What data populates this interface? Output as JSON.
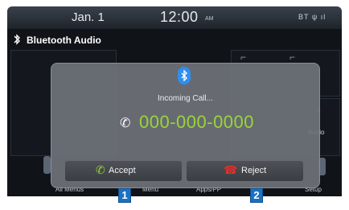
{
  "status_bar": {
    "date": "Jan. 1",
    "time": "12:00",
    "ampm": "AM",
    "icons_text": "BT ψ ıl"
  },
  "header": {
    "bt_icon": "bluetooth-phone-icon",
    "title": "Bluetooth Audio"
  },
  "background": {
    "side_label": "Audio"
  },
  "bottom_menu": {
    "items": [
      "All Menus",
      "Menu",
      "Apps/PP",
      "Setup"
    ]
  },
  "popup": {
    "bt_icon": "bluetooth-icon",
    "title": "Incoming Call...",
    "phone_number": "000-000-0000",
    "accept_label": "Accept",
    "reject_label": "Reject"
  },
  "callouts": [
    "1",
    "2"
  ],
  "colors": {
    "accent_green": "#9ad43a",
    "reject_red": "#e0302a",
    "bluetooth_blue": "#2d8ff0",
    "callout_blue": "#1a72c4"
  }
}
